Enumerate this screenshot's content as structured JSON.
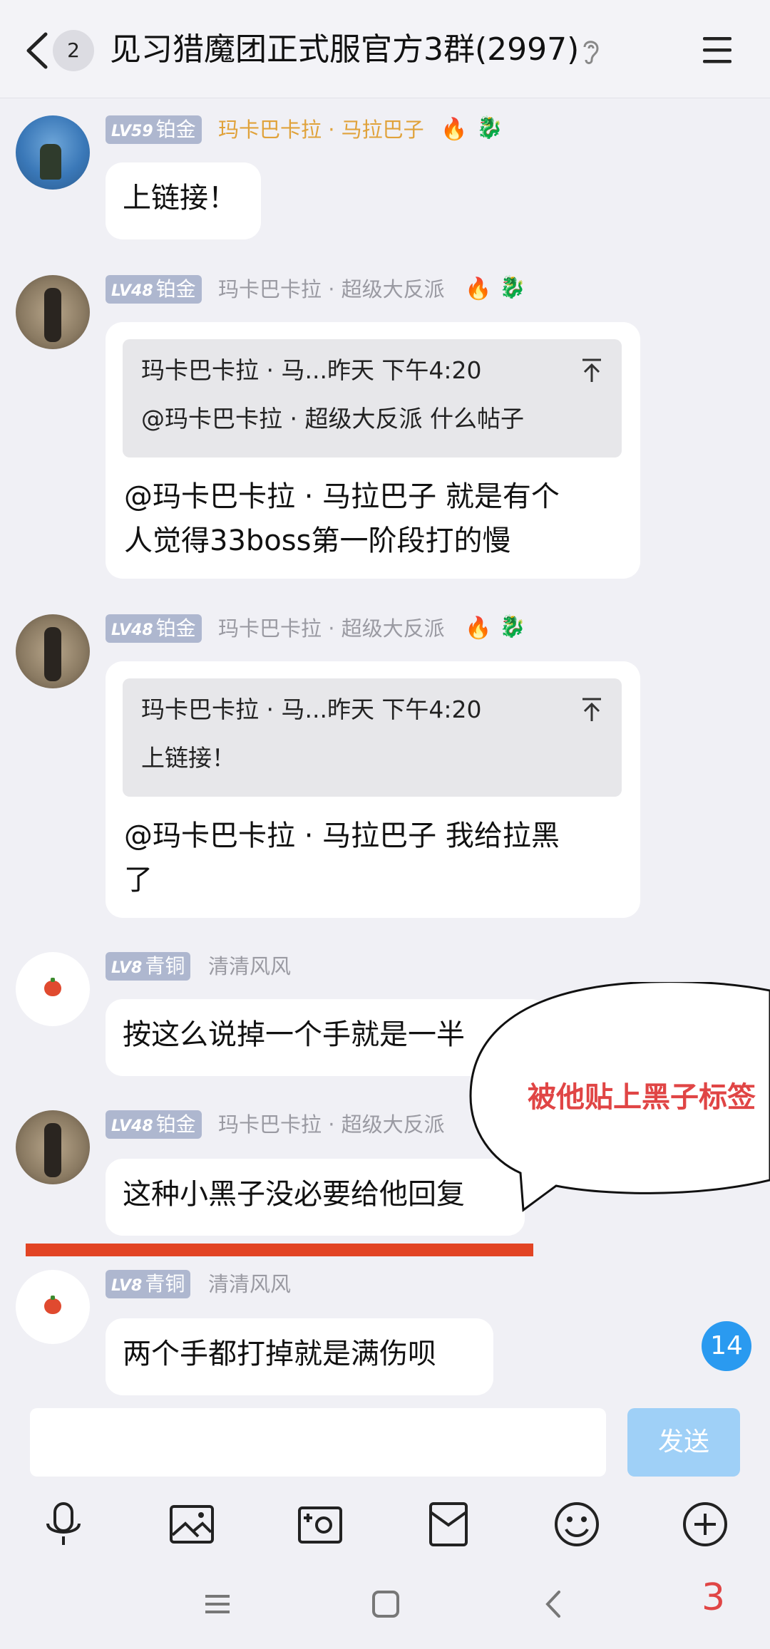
{
  "header": {
    "unread_count": "2",
    "title": "见习猎魔团正式服官方3群(2997)"
  },
  "messages": [
    {
      "level": "LV59",
      "rank": "铂金",
      "nickname": "玛卡巴卡拉 · 马拉巴子",
      "text": "上链接！"
    },
    {
      "level": "LV48",
      "rank": "铂金",
      "nickname": "玛卡巴卡拉 · 超级大反派",
      "quote_head": "玛卡巴卡拉 · 马...昨天 下午4:20",
      "quote_body": "@玛卡巴卡拉 · 超级大反派 什么帖子",
      "text_line1": "@玛卡巴卡拉 · 马拉巴子 就是有个",
      "text_line2": "人觉得33boss第一阶段打的慢"
    },
    {
      "level": "LV48",
      "rank": "铂金",
      "nickname": "玛卡巴卡拉 · 超级大反派",
      "quote_head": "玛卡巴卡拉 · 马...昨天 下午4:20",
      "quote_body": "上链接！",
      "text_line1": "@玛卡巴卡拉 · 马拉巴子 我给拉黑",
      "text_line2": "了"
    },
    {
      "level": "LV8",
      "rank": "青铜",
      "nickname": "清清风风",
      "text": "按这么说掉一个手就是一半"
    },
    {
      "level": "LV48",
      "rank": "铂金",
      "nickname": "玛卡巴卡拉 · 超级大反派",
      "text": "这种小黑子没必要给他回复"
    },
    {
      "level": "LV8",
      "rank": "青铜",
      "nickname": "清清风风",
      "text": "两个手都打掉就是满伤呗"
    }
  ],
  "annotation": {
    "balloon_text": "被他贴上黑子标签",
    "page_number": "3"
  },
  "unread_bubble": "14",
  "composer": {
    "input_value": "",
    "send_label": "发送"
  },
  "colors": {
    "accent_blue": "#2a9af0",
    "send_disabled": "#9fd0f7",
    "annotation_red": "#e04545",
    "underline_red": "#e24424",
    "gold_nick": "#e0a23a"
  }
}
